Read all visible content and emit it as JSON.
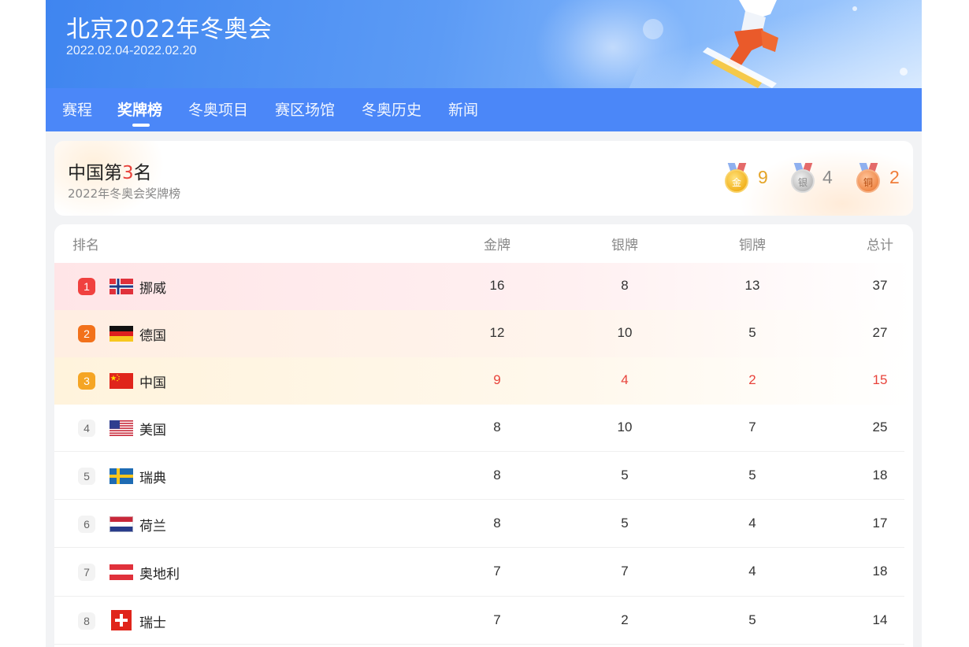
{
  "header": {
    "title": "北京2022年冬奥会",
    "dates": "2022.02.04-2022.02.20"
  },
  "tabs": [
    {
      "label": "赛程",
      "active": false
    },
    {
      "label": "奖牌榜",
      "active": true
    },
    {
      "label": "冬奥项目",
      "active": false
    },
    {
      "label": "赛区场馆",
      "active": false
    },
    {
      "label": "冬奥历史",
      "active": false
    },
    {
      "label": "新闻",
      "active": false
    }
  ],
  "summary": {
    "rank_prefix": "中国第",
    "rank_number": "3",
    "rank_suffix": "名",
    "subtitle": "2022年冬奥会奖牌榜",
    "medals": [
      {
        "icon": "gold-medal-icon",
        "glyph": "金",
        "count": "9",
        "color": "#e4a427"
      },
      {
        "icon": "silver-medal-icon",
        "glyph": "银",
        "count": "4",
        "color": "#8c8c8c"
      },
      {
        "icon": "bronze-medal-icon",
        "glyph": "铜",
        "count": "2",
        "color": "#f07d39"
      }
    ]
  },
  "table": {
    "columns": [
      "排名",
      "金牌",
      "银牌",
      "铜牌",
      "总计"
    ],
    "rows": [
      {
        "rank": "1",
        "flag": "norway-flag-icon",
        "country": "挪威",
        "gold": "16",
        "silver": "8",
        "bronze": "13",
        "total": "37"
      },
      {
        "rank": "2",
        "flag": "germany-flag-icon",
        "country": "德国",
        "gold": "12",
        "silver": "10",
        "bronze": "5",
        "total": "27"
      },
      {
        "rank": "3",
        "flag": "china-flag-icon",
        "country": "中国",
        "gold": "9",
        "silver": "4",
        "bronze": "2",
        "total": "15"
      },
      {
        "rank": "4",
        "flag": "usa-flag-icon",
        "country": "美国",
        "gold": "8",
        "silver": "10",
        "bronze": "7",
        "total": "25"
      },
      {
        "rank": "5",
        "flag": "sweden-flag-icon",
        "country": "瑞典",
        "gold": "8",
        "silver": "5",
        "bronze": "5",
        "total": "18"
      },
      {
        "rank": "6",
        "flag": "netherlands-flag-icon",
        "country": "荷兰",
        "gold": "8",
        "silver": "5",
        "bronze": "4",
        "total": "17"
      },
      {
        "rank": "7",
        "flag": "austria-flag-icon",
        "country": "奥地利",
        "gold": "7",
        "silver": "7",
        "bronze": "4",
        "total": "18"
      },
      {
        "rank": "8",
        "flag": "switzerland-flag-icon",
        "country": "瑞士",
        "gold": "7",
        "silver": "2",
        "bronze": "5",
        "total": "14"
      }
    ]
  },
  "colors": {
    "tab_bar": "#4b87f8",
    "highlight_red": "#e8433b",
    "rank1_badge": "#f0413f",
    "rank2_badge": "#f2711b",
    "rank3_badge": "#f5a524"
  }
}
